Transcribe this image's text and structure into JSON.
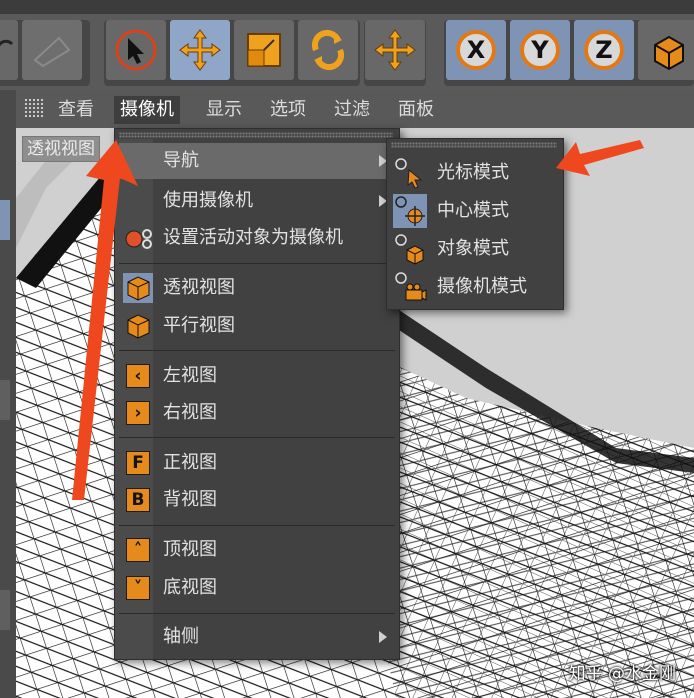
{
  "viewport_menu": {
    "items": [
      "查看",
      "摄像机",
      "显示",
      "选项",
      "过滤",
      "面板"
    ],
    "selected_index": 1
  },
  "viewport": {
    "label": "透视视图"
  },
  "toolbar": {
    "axis_x": "X",
    "axis_y": "Y",
    "axis_z": "Z"
  },
  "camera_menu": {
    "navigation": "导航",
    "use_camera": "使用摄像机",
    "set_active_as_camera": "设置活动对象为摄像机",
    "perspective_view": "透视视图",
    "parallel_view": "平行视图",
    "left_view": "左视图",
    "right_view": "右视图",
    "front_view": "正视图",
    "back_view": "背视图",
    "top_view": "顶视图",
    "bottom_view": "底视图",
    "axonometric": "轴侧",
    "icon_letters": {
      "front": "F",
      "back": "B"
    }
  },
  "navigation_submenu": {
    "items": [
      "光标模式",
      "中心模式",
      "对象模式",
      "摄像机模式"
    ]
  },
  "colors": {
    "accent_orange": "#e68a1c",
    "annotation_red": "#f0481e",
    "menu_bg": "#414141"
  },
  "watermark": "知乎 @水金刚"
}
